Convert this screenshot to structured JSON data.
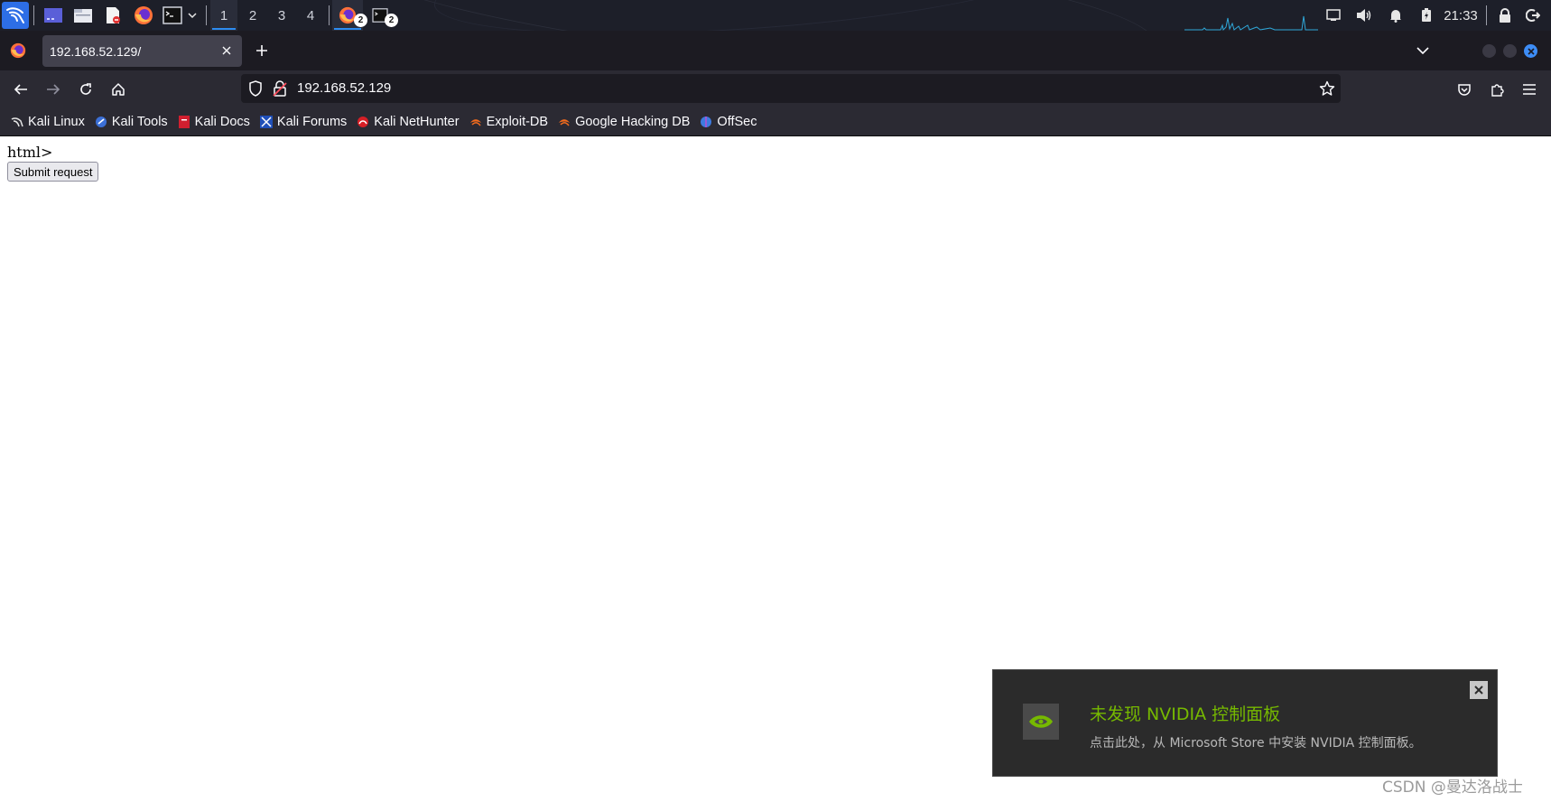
{
  "panel": {
    "workspaces": [
      "1",
      "2",
      "3",
      "4"
    ],
    "active_workspace": "1",
    "firefox_window_count": "2",
    "terminal_window_count": "2",
    "clock": "21:33",
    "icons": [
      "kali-menu-icon",
      "show-desktop-icon",
      "file-manager-icon",
      "text-editor-icon",
      "firefox-icon",
      "terminal-icon",
      "chevron-down-icon",
      "network-icon",
      "volume-icon",
      "notification-bell-icon",
      "battery-icon",
      "lock-icon",
      "logout-icon"
    ],
    "accent_color": "#2d8cf0"
  },
  "browser": {
    "tab_title": "192.168.52.129/",
    "url": "192.168.52.129",
    "bookmarks": [
      {
        "label": "Kali Linux",
        "icon": "kali-dragon-icon"
      },
      {
        "label": "Kali Tools",
        "icon": "kali-tools-icon"
      },
      {
        "label": "Kali Docs",
        "icon": "kali-docs-icon"
      },
      {
        "label": "Kali Forums",
        "icon": "kali-forums-icon"
      },
      {
        "label": "Kali NetHunter",
        "icon": "nethunter-icon"
      },
      {
        "label": "Exploit-DB",
        "icon": "exploit-db-icon"
      },
      {
        "label": "Google Hacking DB",
        "icon": "ghdb-icon"
      },
      {
        "label": "OffSec",
        "icon": "offsec-icon"
      }
    ]
  },
  "page": {
    "text": "html>",
    "submit_label": "Submit request"
  },
  "toast": {
    "title": "未发现 NVIDIA 控制面板",
    "body": "点击此处，从 Microsoft Store 中安装 NVIDIA 控制面板。",
    "title_color": "#76b900"
  },
  "watermark": "CSDN @曼达洛战士"
}
